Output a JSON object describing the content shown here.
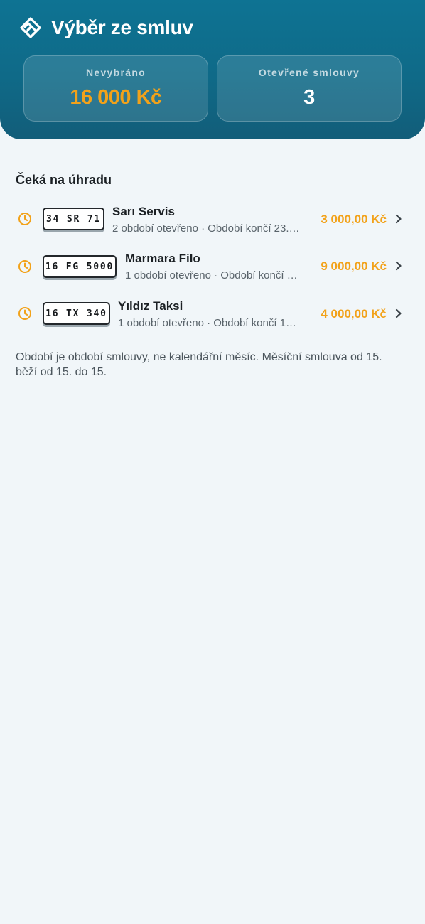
{
  "header": {
    "title": "Výběr ze smluv",
    "logo_icon": "handshake-heart-icon",
    "stats": [
      {
        "label": "Nevybráno",
        "value": "16 000 Kč",
        "color": "#f2a21a"
      },
      {
        "label": "Otevřené smlouvy",
        "value": "3",
        "color": "#ffffff"
      }
    ]
  },
  "pending": {
    "title": "Čeká na úhradu",
    "status_icon": "clock-icon",
    "accent_color": "#f2a21a",
    "items": [
      {
        "plate": "34 SR 71",
        "name": "Sarı Servis",
        "subtitle": "2 období otevřeno · Období končí 23.…",
        "amount": "3 000,00 Kč"
      },
      {
        "plate": "16 FG 5000",
        "name": "Marmara Filo",
        "subtitle": "1 období otevřeno · Období končí …",
        "amount": "9 000,00 Kč"
      },
      {
        "plate": "16 TX 340",
        "name": "Yıldız Taksi",
        "subtitle": "1 období otevřeno · Období končí 1…",
        "amount": "4 000,00 Kč"
      }
    ]
  },
  "note": "Období je období smlouvy, ne kalendářní měsíc. Měsíční smlouva od 15. běží od 15. do 15."
}
